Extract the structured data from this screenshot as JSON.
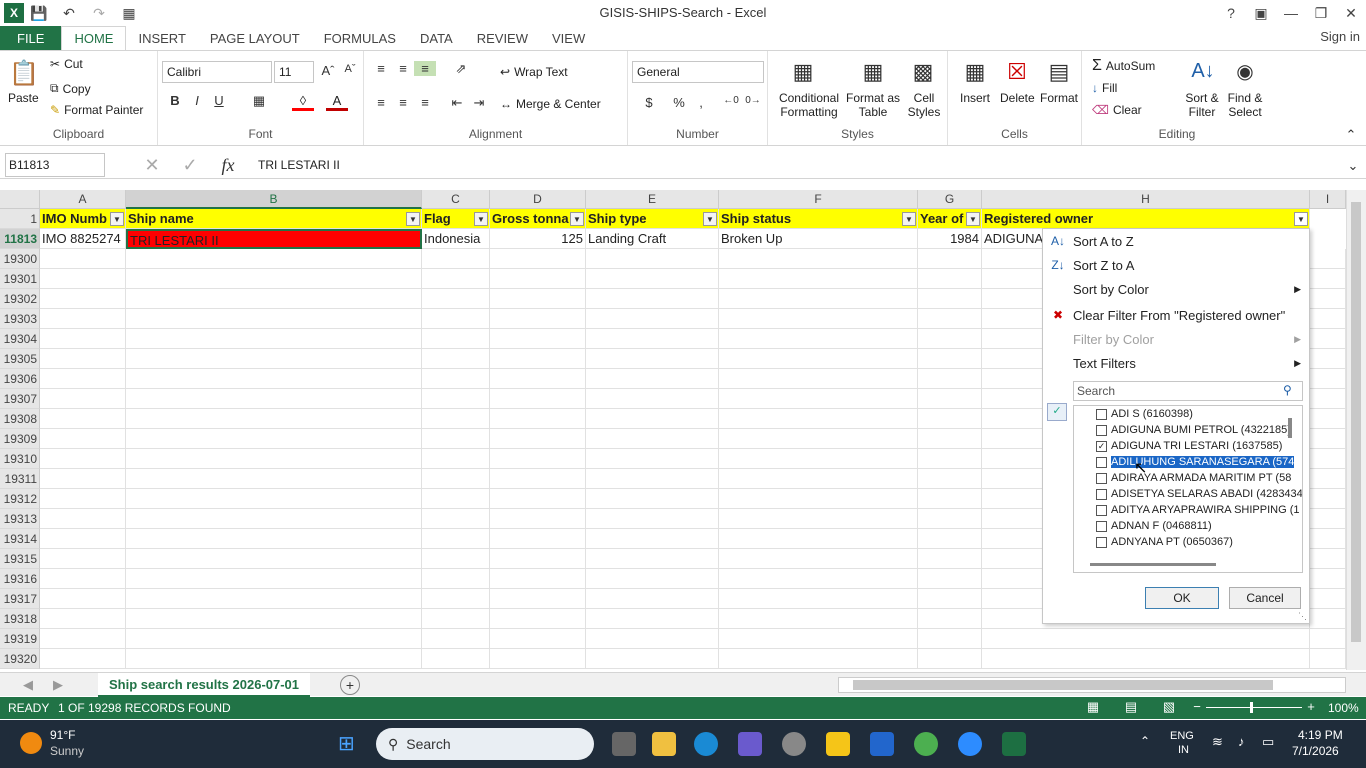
{
  "window": {
    "title": "GISIS-SHIPS-Search - Excel"
  },
  "tabs": [
    "FILE",
    "HOME",
    "INSERT",
    "PAGE LAYOUT",
    "FORMULAS",
    "DATA",
    "REVIEW",
    "VIEW"
  ],
  "signin": "Sign in",
  "ribbon": {
    "clipboard": {
      "paste": "Paste",
      "cut": "Cut",
      "copy": "Copy",
      "format_painter": "Format Painter",
      "label": "Clipboard"
    },
    "font": {
      "name": "Calibri",
      "size": "11",
      "label": "Font",
      "bold": "B",
      "italic": "I",
      "underline": "U"
    },
    "alignment": {
      "wrap": "Wrap Text",
      "merge": "Merge & Center",
      "label": "Alignment"
    },
    "number": {
      "format": "General",
      "label": "Number",
      "currency": "$",
      "percent": "%",
      "comma": ","
    },
    "styles": {
      "conditional": "Conditional",
      "conditional2": "Formatting",
      "format_table": "Format as",
      "format_table2": "Table",
      "cell_styles": "Cell",
      "cell_styles2": "Styles",
      "label": "Styles"
    },
    "cells": {
      "insert": "Insert",
      "delete": "Delete",
      "format": "Format",
      "label": "Cells"
    },
    "editing": {
      "autosum": "AutoSum",
      "fill": "Fill",
      "clear": "Clear",
      "sort": "Sort &",
      "sort2": "Filter",
      "find": "Find &",
      "find2": "Select",
      "label": "Editing"
    }
  },
  "formula_bar": {
    "name_box": "B11813",
    "value": "TRI LESTARI II"
  },
  "columns": [
    "A",
    "B",
    "C",
    "D",
    "E",
    "F",
    "G",
    "H",
    "I"
  ],
  "header_row": {
    "row": "1",
    "cells": [
      "IMO Numb",
      "Ship name",
      "Flag",
      "Gross tonna",
      "Ship type",
      "Ship status",
      "Year of",
      "Registered owner"
    ]
  },
  "data_row": {
    "row": "11813",
    "cells": [
      "IMO 8825274",
      "TRI LESTARI II",
      "Indonesia",
      "125",
      "Landing Craft",
      "Broken Up",
      "1984",
      "ADIGUNA"
    ]
  },
  "empty_rows": [
    "19300",
    "19301",
    "19302",
    "19303",
    "19304",
    "19305",
    "19306",
    "19307",
    "19308",
    "19309",
    "19310",
    "19311",
    "19312",
    "19313",
    "19314",
    "19315",
    "19316",
    "19317",
    "19318",
    "19319",
    "19320"
  ],
  "filter_menu": {
    "sort_az": "Sort A to Z",
    "sort_za": "Sort Z to A",
    "sort_color": "Sort by Color",
    "clear_filter": "Clear Filter From \"Registered owner\"",
    "filter_color": "Filter by Color",
    "text_filters": "Text Filters",
    "search_placeholder": "Search",
    "items": [
      {
        "label": "ADI S (6160398)",
        "checked": false
      },
      {
        "label": "ADIGUNA BUMI PETROL (4322185)",
        "checked": false
      },
      {
        "label": "ADIGUNA TRI LESTARI (1637585)",
        "checked": true
      },
      {
        "label": "ADILUHUNG SARANASEGARA (574",
        "checked": false
      },
      {
        "label": "ADIRAYA ARMADA MARITIM PT (58",
        "checked": false
      },
      {
        "label": "ADISETYA SELARAS ABADI (4283434",
        "checked": false
      },
      {
        "label": "ADITYA ARYAPRAWIRA SHIPPING (1",
        "checked": false
      },
      {
        "label": "ADNAN F (0468811)",
        "checked": false
      },
      {
        "label": "ADNYANA PT (0650367)",
        "checked": false
      }
    ],
    "ok": "OK",
    "cancel": "Cancel"
  },
  "sheet_tab": "Ship search results 2026-07-01",
  "status": {
    "ready": "READY",
    "records": "1 OF 19298 RECORDS FOUND",
    "zoom": "100%"
  },
  "taskbar": {
    "temp": "91°F",
    "weather": "Sunny",
    "search": "Search",
    "lang": "ENG",
    "region": "IN",
    "time": "4:19 PM",
    "date": "7/1/2026"
  },
  "colors": {
    "excel_green": "#217346",
    "header_fill": "#ffff00",
    "selected_fill": "#ff0000"
  }
}
